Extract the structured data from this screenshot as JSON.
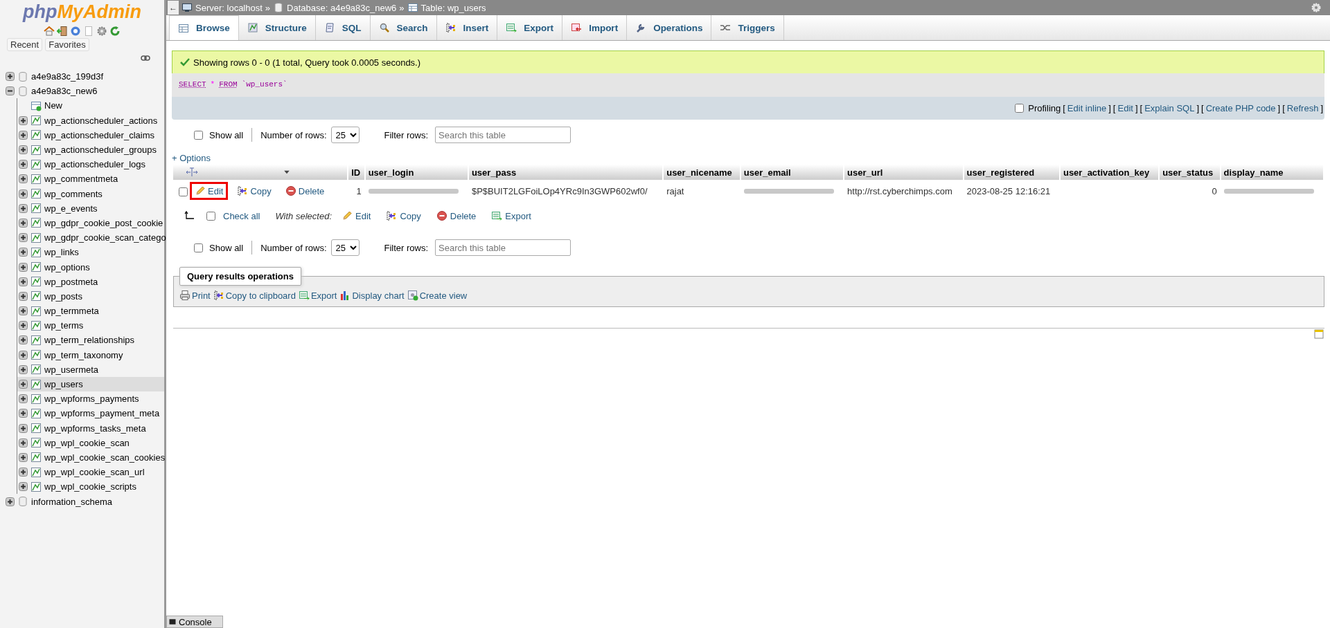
{
  "sidebar": {
    "logo": {
      "left": "php",
      "right": "MyAdmin"
    },
    "buttons": [
      "Recent",
      "Favorites"
    ],
    "tree": [
      {
        "label": "a4e9a83c_199d3f",
        "expanded": false
      },
      {
        "label": "a4e9a83c_new6",
        "expanded": true,
        "children": [
          {
            "label": "New",
            "kind": "new",
            "selected": false
          },
          {
            "label": "wp_actionscheduler_actions",
            "kind": "table",
            "selected": false
          },
          {
            "label": "wp_actionscheduler_claims",
            "kind": "table",
            "selected": false
          },
          {
            "label": "wp_actionscheduler_groups",
            "kind": "table",
            "selected": false
          },
          {
            "label": "wp_actionscheduler_logs",
            "kind": "table",
            "selected": false
          },
          {
            "label": "wp_commentmeta",
            "kind": "table",
            "selected": false
          },
          {
            "label": "wp_comments",
            "kind": "table",
            "selected": false
          },
          {
            "label": "wp_e_events",
            "kind": "table",
            "selected": false
          },
          {
            "label": "wp_gdpr_cookie_post_cookie",
            "kind": "table",
            "selected": false
          },
          {
            "label": "wp_gdpr_cookie_scan_catego",
            "kind": "table",
            "selected": false
          },
          {
            "label": "wp_links",
            "kind": "table",
            "selected": false
          },
          {
            "label": "wp_options",
            "kind": "table",
            "selected": false
          },
          {
            "label": "wp_postmeta",
            "kind": "table",
            "selected": false
          },
          {
            "label": "wp_posts",
            "kind": "table",
            "selected": false
          },
          {
            "label": "wp_termmeta",
            "kind": "table",
            "selected": false
          },
          {
            "label": "wp_terms",
            "kind": "table",
            "selected": false
          },
          {
            "label": "wp_term_relationships",
            "kind": "table",
            "selected": false
          },
          {
            "label": "wp_term_taxonomy",
            "kind": "table",
            "selected": false
          },
          {
            "label": "wp_usermeta",
            "kind": "table",
            "selected": false
          },
          {
            "label": "wp_users",
            "kind": "table",
            "selected": true
          },
          {
            "label": "wp_wpforms_payments",
            "kind": "table",
            "selected": false
          },
          {
            "label": "wp_wpforms_payment_meta",
            "kind": "table",
            "selected": false
          },
          {
            "label": "wp_wpforms_tasks_meta",
            "kind": "table",
            "selected": false
          },
          {
            "label": "wp_wpl_cookie_scan",
            "kind": "table",
            "selected": false
          },
          {
            "label": "wp_wpl_cookie_scan_cookies",
            "kind": "table",
            "selected": false
          },
          {
            "label": "wp_wpl_cookie_scan_url",
            "kind": "table",
            "selected": false
          },
          {
            "label": "wp_wpl_cookie_scripts",
            "kind": "table",
            "selected": false
          }
        ]
      },
      {
        "label": "information_schema",
        "expanded": false
      }
    ]
  },
  "breadcrumb": {
    "back": "←",
    "separator": "»",
    "items": [
      "Server: localhost",
      "Database: a4e9a83c_new6",
      "Table: wp_users"
    ]
  },
  "tabs": [
    {
      "label": "Browse",
      "selected": true
    },
    {
      "label": "Structure",
      "selected": false
    },
    {
      "label": "SQL",
      "selected": false
    },
    {
      "label": "Search",
      "selected": false
    },
    {
      "label": "Insert",
      "selected": false
    },
    {
      "label": "Export",
      "selected": false
    },
    {
      "label": "Import",
      "selected": false
    },
    {
      "label": "Operations",
      "selected": false
    },
    {
      "label": "Triggers",
      "selected": false
    }
  ],
  "message": "Showing rows 0 - 0 (1 total, Query took 0.0005 seconds.)",
  "sql": [
    {
      "text": "SELECT",
      "kind": "keyword"
    },
    {
      "text": "*",
      "kind": "operator"
    },
    {
      "text": "FROM",
      "kind": "keyword"
    },
    {
      "text": "`wp_users`",
      "kind": "identifier"
    }
  ],
  "profiling": {
    "label": "Profiling",
    "checked": false,
    "brackets": [
      "[",
      "]"
    ],
    "links": [
      "Edit inline",
      "Edit",
      "Explain SQL",
      "Create PHP code",
      "Refresh"
    ]
  },
  "nav_top": {
    "show_all": {
      "label": "Show all",
      "checked": false
    },
    "rows_label": "Number of rows:",
    "rows_value": "25",
    "filter_label": "Filter rows:",
    "filter_placeholder": "Search this table"
  },
  "options": "+ Options",
  "table": {
    "columns": [
      "ID",
      "user_login",
      "user_pass",
      "user_nicename",
      "user_email",
      "user_url",
      "user_registered",
      "user_activation_key",
      "user_status",
      "display_name"
    ],
    "rows": [
      {
        "checked": false,
        "actions": [
          {
            "label": "Edit",
            "highlighted": true
          },
          {
            "label": "Copy",
            "highlighted": false
          },
          {
            "label": "Delete",
            "highlighted": false
          }
        ],
        "cells": [
          {
            "text": "1",
            "kind": "number"
          },
          {
            "kind": "redacted"
          },
          {
            "text": "$P$BUIT2LGFoiLOp4YRc9In3GWP602wf0/",
            "kind": "text"
          },
          {
            "text": "rajat",
            "kind": "text"
          },
          {
            "kind": "redacted"
          },
          {
            "text": "http://rst.cyberchimps.com",
            "kind": "text"
          },
          {
            "text": "2023-08-25 12:16:21",
            "kind": "text"
          },
          null,
          {
            "text": "0",
            "kind": "number"
          },
          {
            "kind": "redacted"
          }
        ]
      }
    ]
  },
  "bulk": {
    "check_all": {
      "label": "Check all",
      "checked": false
    },
    "with_selected": "With selected:",
    "actions": [
      "Edit",
      "Copy",
      "Delete",
      "Export"
    ]
  },
  "nav_bottom": {
    "show_all": {
      "label": "Show all",
      "checked": false
    },
    "rows_label": "Number of rows:",
    "rows_value": "25",
    "filter_label": "Filter rows:",
    "filter_placeholder": "Search this table"
  },
  "query_ops": {
    "legend": "Query results operations",
    "links": [
      "Print",
      "Copy to clipboard",
      "Export",
      "Display chart",
      "Create view"
    ]
  },
  "console": "Console"
}
